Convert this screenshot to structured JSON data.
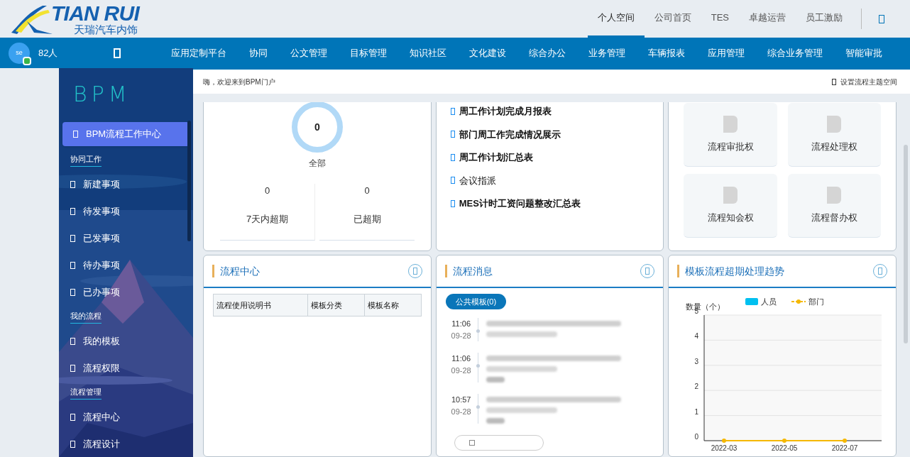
{
  "logo": {
    "brand": "TIAN RUI",
    "subtitle": "天瑞汽车内饰"
  },
  "top_links": [
    {
      "label": "个人空间",
      "selected": true
    },
    {
      "label": "公司首页",
      "selected": false
    },
    {
      "label": "TES",
      "selected": false
    },
    {
      "label": "卓越运营",
      "selected": false
    },
    {
      "label": "员工激励",
      "selected": false
    }
  ],
  "user": {
    "avatar": "se",
    "online_count": "82人"
  },
  "nav": [
    "应用定制平台",
    "协同",
    "公文管理",
    "目标管理",
    "知识社区",
    "文化建设",
    "综合办公",
    "业务管理",
    "车辆报表",
    "应用管理",
    "综合业务管理",
    "智能审批"
  ],
  "sidebar": {
    "title": "BPM",
    "items": [
      {
        "kind": "item",
        "label": "BPM流程工作中心",
        "selected": true
      },
      {
        "kind": "heading",
        "label": "协同工作"
      },
      {
        "kind": "item",
        "label": "新建事项",
        "selected": false
      },
      {
        "kind": "item",
        "label": "待发事项",
        "selected": false
      },
      {
        "kind": "item",
        "label": "已发事项",
        "selected": false
      },
      {
        "kind": "item",
        "label": "待办事项",
        "selected": false
      },
      {
        "kind": "item",
        "label": "已办事项",
        "selected": false
      },
      {
        "kind": "heading",
        "label": "我的流程"
      },
      {
        "kind": "item",
        "label": "我的模板",
        "selected": false
      },
      {
        "kind": "item",
        "label": "流程权限",
        "selected": false
      },
      {
        "kind": "heading",
        "label": "流程管理"
      },
      {
        "kind": "item",
        "label": "流程中心",
        "selected": false
      },
      {
        "kind": "item",
        "label": "流程设计",
        "selected": false
      }
    ]
  },
  "welcome": "嗨，欢迎来到BPM门户",
  "settings_link": "设置流程主题空间",
  "summary": {
    "total": "0",
    "total_label": "全部",
    "stats": [
      {
        "value": "0",
        "label": "7天内超期"
      },
      {
        "value": "0",
        "label": "已超期"
      }
    ]
  },
  "reports": [
    {
      "label": "周工作计划完成月报表",
      "bold": true
    },
    {
      "label": "部门周工作完成情况展示",
      "bold": true
    },
    {
      "label": "周工作计划汇总表",
      "bold": true
    },
    {
      "label": "会议指派",
      "bold": false
    },
    {
      "label": "MES计时工资问题整改汇总表",
      "bold": true
    }
  ],
  "permissions": [
    "流程审批权",
    "流程处理权",
    "流程知会权",
    "流程督办权"
  ],
  "process_center": {
    "title": "流程中心",
    "columns": [
      "流程使用说明书",
      "模板分类",
      "模板名称"
    ]
  },
  "messages": {
    "title": "流程消息",
    "tabs": [
      {
        "label": "公共模板(0)",
        "selected": true
      }
    ],
    "items": [
      {
        "time": "11:06",
        "date": "09-28"
      },
      {
        "time": "11:06",
        "date": "09-28"
      },
      {
        "time": "10:57",
        "date": "09-28"
      }
    ]
  },
  "trend": {
    "title": "模板流程超期处理趋势",
    "chart_data": {
      "type": "line",
      "ylabel": "数量（个）",
      "categories": [
        "2022-03",
        "2022-05",
        "2022-07"
      ],
      "ylim": [
        0,
        5
      ],
      "yticks": [
        0,
        1,
        2,
        3,
        4,
        5
      ],
      "grid": true,
      "legend": "top",
      "series": [
        {
          "name": "人员",
          "color": "#00c0f0",
          "values": [
            null,
            null,
            null
          ]
        },
        {
          "name": "部门",
          "color": "#f5b800",
          "marker": "circle",
          "values": [
            0,
            0,
            0
          ]
        }
      ]
    }
  }
}
